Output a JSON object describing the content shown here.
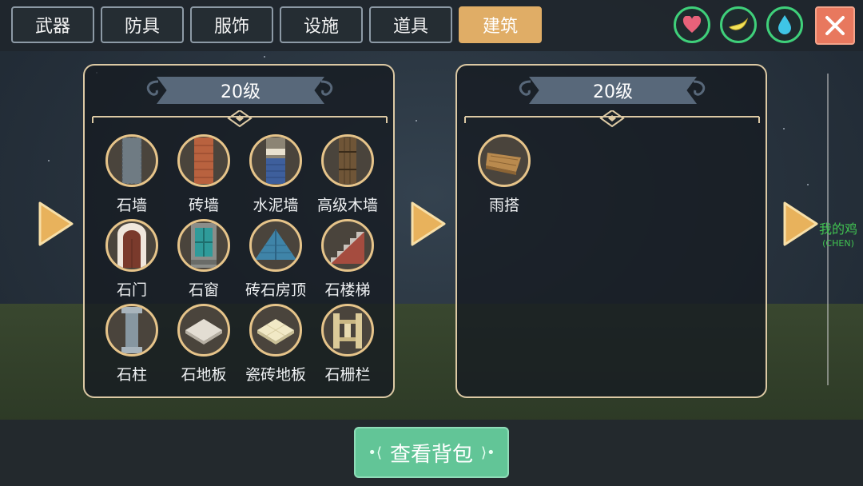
{
  "tabs": [
    {
      "label": "武器",
      "active": false
    },
    {
      "label": "防具",
      "active": false
    },
    {
      "label": "服饰",
      "active": false
    },
    {
      "label": "设施",
      "active": false
    },
    {
      "label": "道具",
      "active": false
    },
    {
      "label": "建筑",
      "active": true
    }
  ],
  "status_icons": [
    "heart-icon",
    "banana-icon",
    "water-drop-icon"
  ],
  "close_icon": "close-icon",
  "left_panel": {
    "level": "20级",
    "items": [
      {
        "label": "石墙",
        "icon": "stone-wall-icon"
      },
      {
        "label": "砖墙",
        "icon": "brick-wall-icon"
      },
      {
        "label": "水泥墙",
        "icon": "cement-wall-icon"
      },
      {
        "label": "高级木墙",
        "icon": "wood-wall-icon"
      },
      {
        "label": "石门",
        "icon": "stone-door-icon"
      },
      {
        "label": "石窗",
        "icon": "stone-window-icon"
      },
      {
        "label": "砖石房顶",
        "icon": "brick-roof-icon"
      },
      {
        "label": "石楼梯",
        "icon": "stone-stairs-icon"
      },
      {
        "label": "石柱",
        "icon": "stone-pillar-icon"
      },
      {
        "label": "石地板",
        "icon": "stone-floor-icon"
      },
      {
        "label": "瓷砖地板",
        "icon": "tile-floor-icon"
      },
      {
        "label": "石栅栏",
        "icon": "stone-fence-icon"
      }
    ]
  },
  "right_panel": {
    "level": "20级",
    "items": [
      {
        "label": "雨搭",
        "icon": "awning-icon"
      }
    ]
  },
  "npc": {
    "name": "我的鸡",
    "sub": "(CHEN)"
  },
  "bag_button": {
    "label": "查看背包"
  },
  "colors": {
    "active_tab": "#e0ad66",
    "status_ring": "#3fd07a",
    "close_button": "#e8785e",
    "panel_border": "#dcc9a4",
    "bag_button": "#62c597",
    "arrow": "#e8b25c"
  }
}
